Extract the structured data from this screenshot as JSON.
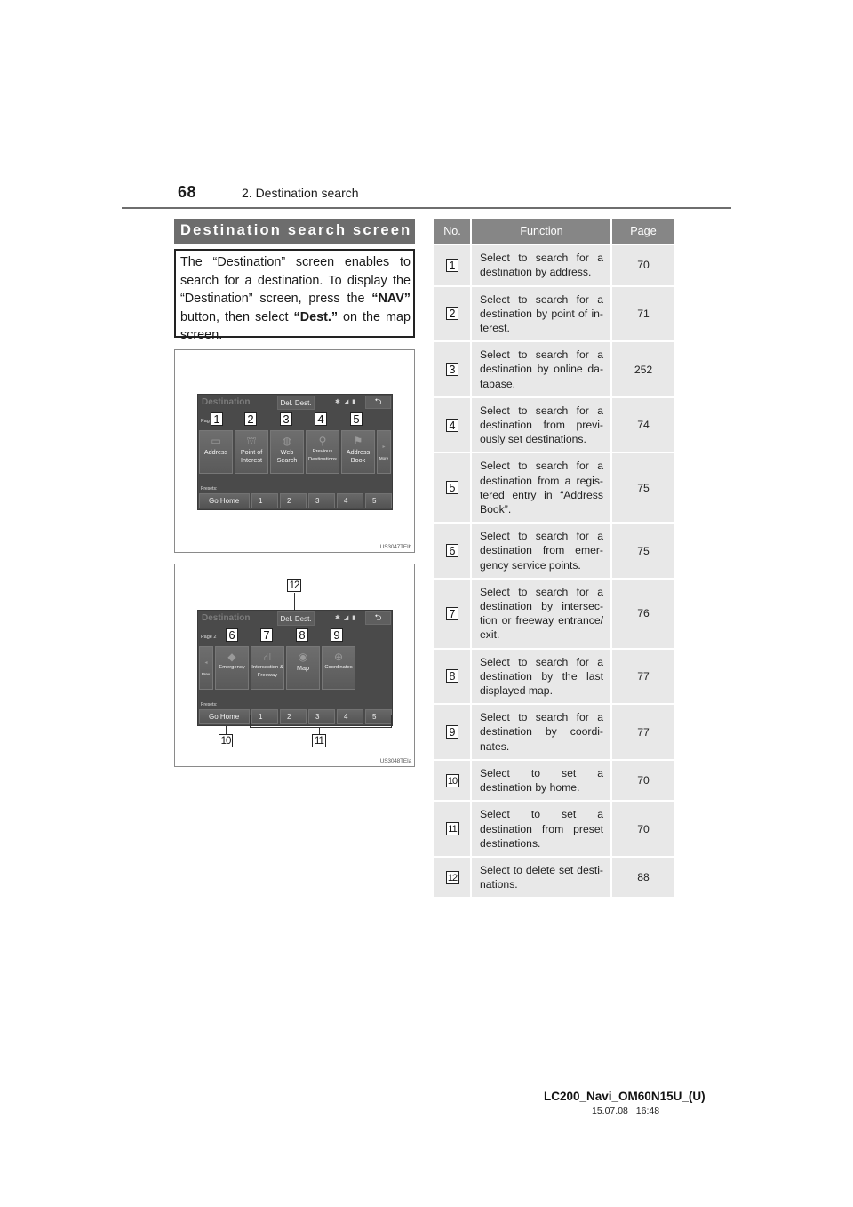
{
  "page_header": {
    "page_number": "68",
    "section_title": "2. Destination search"
  },
  "heading": "Destination search screen",
  "intro": {
    "part1": "The “Destination” screen enables to search for a destination. To display the “Destination” screen, press the ",
    "bold1": "“NAV”",
    "part2": " button, then select ",
    "bold2": "“Dest.”",
    "part3": " on the map screen."
  },
  "figure1": {
    "code": "US3047TEIb",
    "screen": {
      "title": "Destination",
      "del_dest": "Del. Dest.",
      "status_icons": "bluetooth-signal-battery",
      "page_label": "Pag",
      "tiles": [
        {
          "label": "Address",
          "icon": "card-icon",
          "callout": "1"
        },
        {
          "label": "Point of Interest",
          "icon": "building-icon",
          "callout": "2"
        },
        {
          "label": "Web Search",
          "icon": "globe-search-icon",
          "callout": "3"
        },
        {
          "label": "Previous Destinations",
          "icon": "history-pin-icon",
          "callout": "4"
        },
        {
          "label": "Address Book",
          "icon": "flag-icon",
          "callout": "5"
        },
        {
          "label": "More",
          "icon": "arrow-right-icon"
        }
      ],
      "presets_label": "Presets:",
      "presets": [
        "Go Home",
        "1",
        "2",
        "3",
        "4",
        "5"
      ]
    }
  },
  "figure2": {
    "code": "US3048TEIa",
    "screen": {
      "title": "Destination",
      "del_dest": "Del. Dest.",
      "page_label": "Page 2",
      "tiles": [
        {
          "label": "Prev.",
          "icon": "arrow-left-icon"
        },
        {
          "label": "Emergency",
          "icon": "warning-diamond-icon",
          "callout": "6"
        },
        {
          "label": "Intersection & Freeway",
          "icon": "road-icon",
          "callout": "7"
        },
        {
          "label": "Map",
          "icon": "compass-icon",
          "callout": "8"
        },
        {
          "label": "Coordinates",
          "icon": "globe-grid-icon",
          "callout": "9"
        }
      ],
      "presets_label": "Presets:",
      "presets": [
        "Go Home",
        "1",
        "2",
        "3",
        "4",
        "5"
      ]
    },
    "callouts": {
      "del_dest": "12",
      "go_home": "10",
      "presets": "11"
    }
  },
  "table": {
    "headers": [
      "No.",
      "Function",
      "Page"
    ],
    "rows": [
      {
        "no": "1",
        "function": "Select to search for a destination by address.",
        "page": "70"
      },
      {
        "no": "2",
        "function": "Select to search for a destination by point of in-terest.",
        "page": "71"
      },
      {
        "no": "3",
        "function": "Select to search for a destination by online da-tabase.",
        "page": "252"
      },
      {
        "no": "4",
        "function": "Select to search for a destination from previ-ously set destinations.",
        "page": "74"
      },
      {
        "no": "5",
        "function": "Select to search for a destination from a regis-tered entry in “Address Book”.",
        "page": "75"
      },
      {
        "no": "6",
        "function": "Select to search for a destination from emer-gency service points.",
        "page": "75"
      },
      {
        "no": "7",
        "function": "Select to search for a destination by intersec-tion or freeway entrance/ exit.",
        "page": "76"
      },
      {
        "no": "8",
        "function": "Select to search for a destination by the last displayed map.",
        "page": "77"
      },
      {
        "no": "9",
        "function": "Select to search for a destination by coordi-nates.",
        "page": "77"
      },
      {
        "no": "10",
        "function": "Select to set a destination by home.",
        "page": "70"
      },
      {
        "no": "11",
        "function": "Select to set a destination from preset destinations.",
        "page": "70"
      },
      {
        "no": "12",
        "function": "Select to delete set desti-nations.",
        "page": "88"
      }
    ]
  },
  "footer": {
    "doc_id": "LC200_Navi_OM60N15U_(U)",
    "date": "15.07.08",
    "time": "16:48"
  }
}
